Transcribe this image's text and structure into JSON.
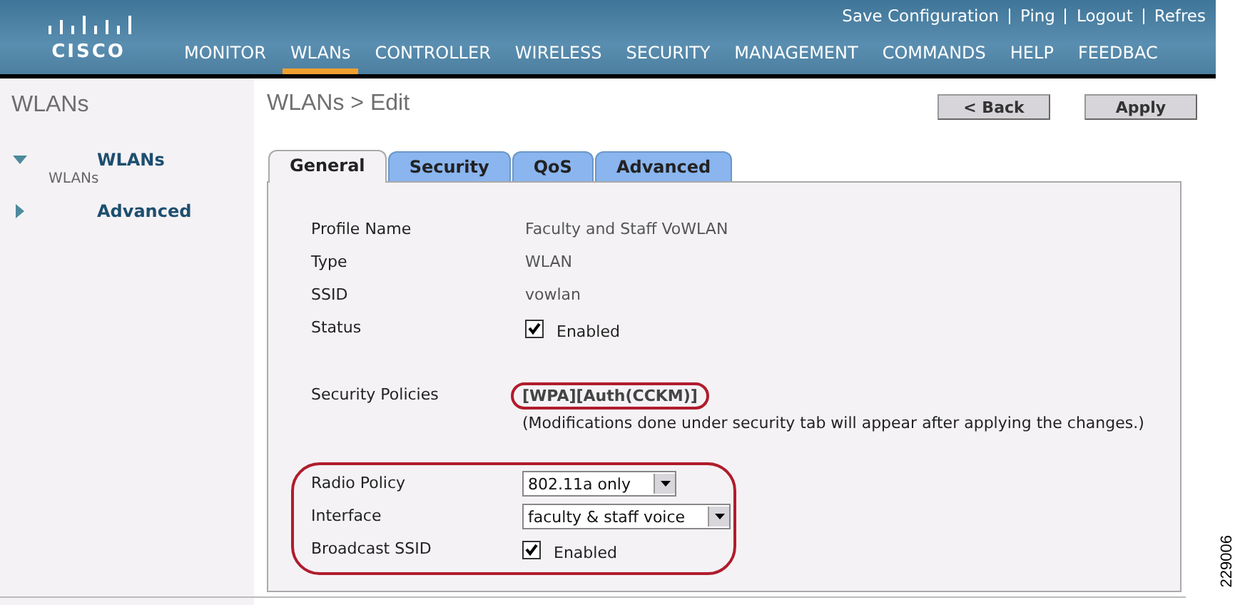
{
  "header": {
    "logo_text": "CISCO",
    "top_links": [
      "Save Configuration",
      "Ping",
      "Logout",
      "Refres"
    ],
    "nav": [
      {
        "label": "MONITOR",
        "selected": false
      },
      {
        "label": "WLANs",
        "selected": true
      },
      {
        "label": "CONTROLLER",
        "selected": false
      },
      {
        "label": "WIRELESS",
        "selected": false
      },
      {
        "label": "SECURITY",
        "selected": false
      },
      {
        "label": "MANAGEMENT",
        "selected": false
      },
      {
        "label": "COMMANDS",
        "selected": false
      },
      {
        "label": "HELP",
        "selected": false
      },
      {
        "label": "FEEDBAC",
        "selected": false
      }
    ]
  },
  "sidebar": {
    "title": "WLANs",
    "items": [
      {
        "label": "WLANs",
        "expanded": true,
        "children": [
          {
            "label": "WLANs"
          }
        ]
      },
      {
        "label": "Advanced",
        "expanded": false
      }
    ]
  },
  "main": {
    "title": "WLANs > Edit",
    "buttons": [
      "< Back",
      "Apply"
    ],
    "tabs": [
      {
        "label": "General",
        "selected": true
      },
      {
        "label": "Security",
        "selected": false
      },
      {
        "label": "QoS",
        "selected": false
      },
      {
        "label": "Advanced",
        "selected": false
      }
    ],
    "sections": [
      {
        "circled": false,
        "rows": [
          {
            "kind": "text",
            "label": "Profile Name",
            "value": "Faculty and Staff VoWLAN"
          },
          {
            "kind": "text",
            "label": "Type",
            "value": "WLAN"
          },
          {
            "kind": "text",
            "label": "SSID",
            "value": "vowlan"
          },
          {
            "kind": "checkbox",
            "label": "Status",
            "checked": true,
            "value": "Enabled"
          }
        ]
      },
      {
        "circled": false,
        "rows": [
          {
            "kind": "policy",
            "label": "Security Policies",
            "value": "[WPA][Auth(CCKM)]",
            "circled": true,
            "note": "(Modifications done under security tab will appear after applying the changes.)"
          }
        ]
      },
      {
        "circled": true,
        "rows": [
          {
            "kind": "select",
            "label": "Radio Policy",
            "value": "802.11a only"
          },
          {
            "kind": "select",
            "label": "Interface",
            "value": "faculty & staff voice"
          },
          {
            "kind": "checkbox",
            "label": "Broadcast SSID",
            "checked": true,
            "value": "Enabled"
          }
        ]
      }
    ]
  },
  "figure_number": "229006"
}
